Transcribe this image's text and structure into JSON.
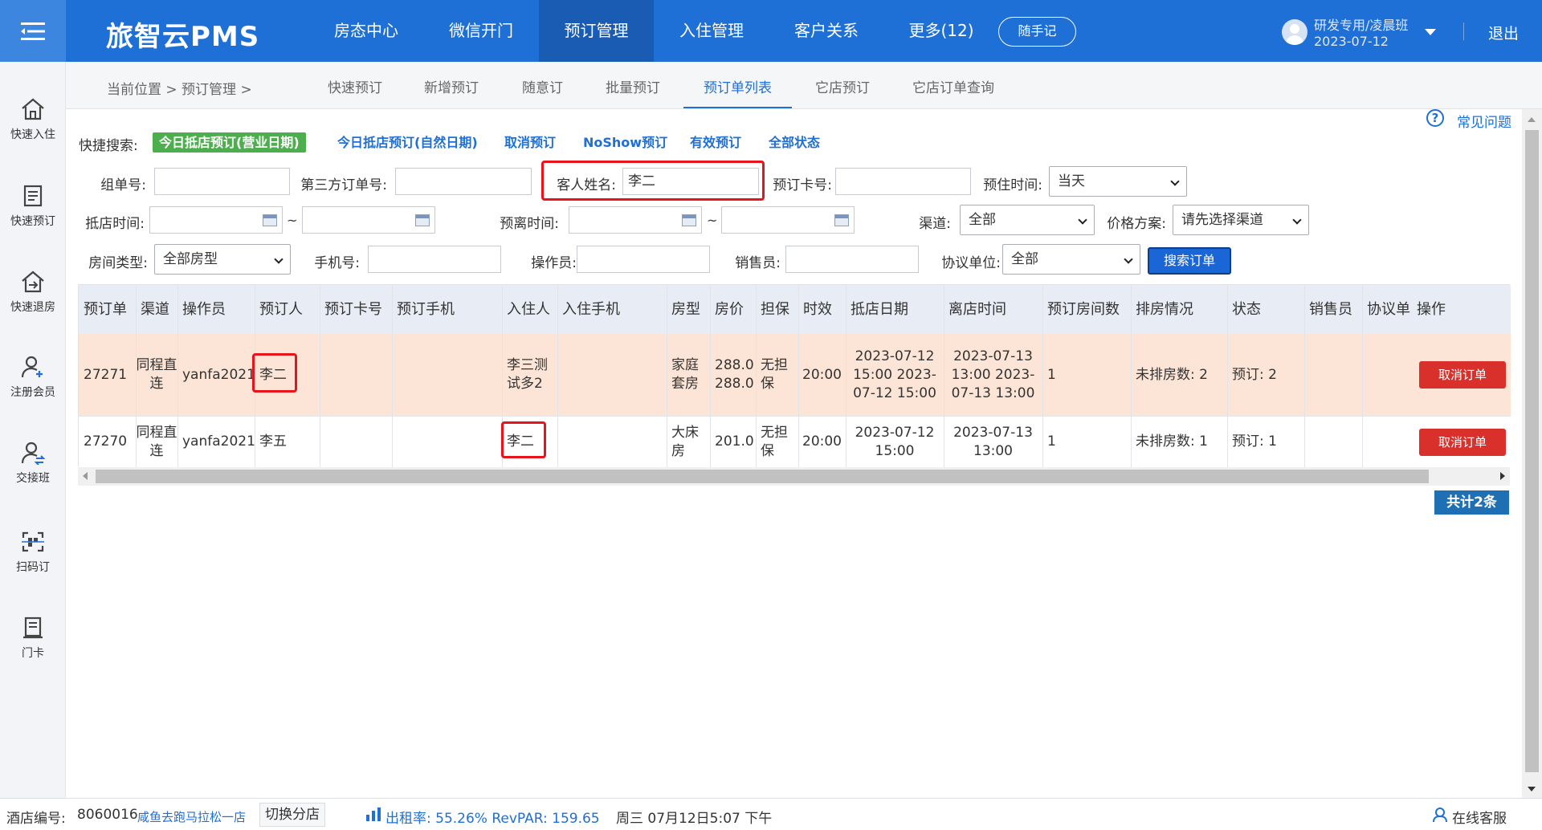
{
  "header": {
    "brand": "旅智云PMS",
    "nav": [
      {
        "label": "房态中心",
        "active": false
      },
      {
        "label": "微信开门",
        "active": false
      },
      {
        "label": "预订管理",
        "active": true
      },
      {
        "label": "入住管理",
        "active": false
      },
      {
        "label": "客户关系",
        "active": false
      },
      {
        "label": "更多(12)",
        "active": false
      }
    ],
    "quick_note": "随手记",
    "user_name": "研发专用/凌晨班",
    "user_date": "2023-07-12",
    "logout": "退出"
  },
  "sidebar": {
    "items": [
      {
        "label": "快速入住",
        "icon": "home-icon"
      },
      {
        "label": "快速预订",
        "icon": "notebook-icon"
      },
      {
        "label": "快速退房",
        "icon": "checkout-house-icon"
      },
      {
        "label": "注册会员",
        "icon": "add-user-icon"
      },
      {
        "label": "交接班",
        "icon": "shift-handover-icon"
      },
      {
        "label": "扫码订",
        "icon": "scan-code-icon"
      },
      {
        "label": "门卡",
        "icon": "door-card-icon"
      }
    ]
  },
  "breadcrumb": {
    "text": "当前位置 > 预订管理 >"
  },
  "tabs": [
    {
      "label": "快速预订",
      "active": false
    },
    {
      "label": "新增预订",
      "active": false
    },
    {
      "label": "随意订",
      "active": false
    },
    {
      "label": "批量预订",
      "active": false
    },
    {
      "label": "预订单列表",
      "active": true
    },
    {
      "label": "它店预订",
      "active": false
    },
    {
      "label": "它店订单查询",
      "active": false
    }
  ],
  "help": {
    "icon": "?",
    "label": "常见问题"
  },
  "quick_search": {
    "label": "快捷搜索:",
    "chips": [
      {
        "label": "今日抵店预订(营业日期)",
        "active": true
      },
      {
        "label": "今日抵店预订(自然日期)",
        "active": false
      },
      {
        "label": "取消预订",
        "active": false
      },
      {
        "label": "NoShow预订",
        "active": false
      },
      {
        "label": "有效预订",
        "active": false
      },
      {
        "label": "全部状态",
        "active": false
      }
    ]
  },
  "form": {
    "group_no_label": "组单号:",
    "group_no_value": "",
    "third_party_label": "第三方订单号:",
    "third_party_value": "",
    "guest_name_label": "客人姓名:",
    "guest_name_value": "李二",
    "booking_card_label": "预订卡号:",
    "booking_card_value": "",
    "stay_time_label": "预住时间:",
    "stay_time_value": "当天",
    "arrival_label": "抵店时间:",
    "arrival_from": "",
    "arrival_to": "",
    "departure_label": "预离时间:",
    "departure_from": "",
    "departure_to": "",
    "tilde": "~",
    "channel_label": "渠道:",
    "channel_value": "全部",
    "price_plan_label": "价格方案:",
    "price_plan_value": "请先选择渠道",
    "room_type_label": "房间类型:",
    "room_type_value": "全部房型",
    "phone_label": "手机号:",
    "phone_value": "",
    "operator_label": "操作员:",
    "operator_value": "",
    "sales_label": "销售员:",
    "sales_value": "",
    "agreement_label": "协议单位:",
    "agreement_value": "全部",
    "search_button": "搜索订单"
  },
  "table": {
    "columns": [
      "预订单",
      "渠道",
      "操作员",
      "预订人",
      "预订卡号",
      "预订手机",
      "入住人",
      "入住手机",
      "房型",
      "房价",
      "担保",
      "时效",
      "抵店日期",
      "离店时间",
      "预订房间数",
      "排房情况",
      "状态",
      "销售员",
      "协议单",
      "操作"
    ],
    "rows": [
      {
        "order_no": "27271",
        "channel": "同程直连",
        "operator": "yanfa2021",
        "booker": "李二",
        "booking_card": "",
        "booking_phone": "",
        "guest": "李三测试多2",
        "guest_phone": "",
        "room_type": "家庭套房",
        "price": "288.0 288.0",
        "guarantee": "无担保",
        "timeliness": "20:00",
        "arrival": "2023-07-12 15:00 2023-07-12 15:00",
        "departure": "2023-07-13 13:00 2023-07-13 13:00",
        "rooms": "1",
        "arrangement": "未排房数: 2",
        "status": "预订: 2",
        "sales": "",
        "agreement": "",
        "action": "取消订单"
      },
      {
        "order_no": "27270",
        "channel": "同程直连",
        "operator": "yanfa2021",
        "booker": "李五",
        "booking_card": "",
        "booking_phone": "",
        "guest": "李二",
        "guest_phone": "",
        "room_type": "大床房",
        "price": "201.0",
        "guarantee": "无担保",
        "timeliness": "20:00",
        "arrival": "2023-07-12 15:00",
        "departure": "2023-07-13 13:00",
        "rooms": "1",
        "arrangement": "未排房数: 1",
        "status": "预订: 1",
        "sales": "",
        "agreement": "",
        "action": "取消订单"
      }
    ]
  },
  "total": "共计2条",
  "statusbar": {
    "hotel_no_label": "酒店编号:",
    "hotel_no": "8060016",
    "hotel_name": "咸鱼去跑马拉松一店",
    "switch_store": "切换分店",
    "occupancy": "出租率: 55.26% RevPAR: 159.65",
    "datetime": "周三 07月12日5:07 下午",
    "online_service": "在线客服"
  },
  "colors": {
    "brand_blue": "#1e6fd6",
    "active_chip_green": "#4cae4c",
    "cancel_red": "#d9302b",
    "highlight_row": "#fce5d6",
    "annotation_red": "#e8141c"
  }
}
